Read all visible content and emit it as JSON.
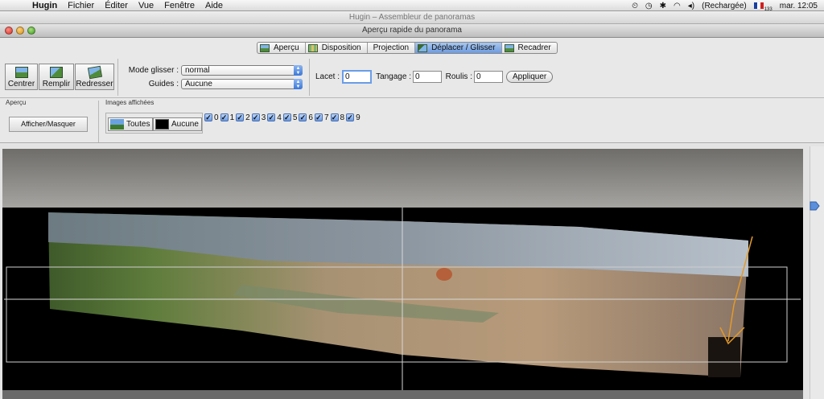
{
  "menubar": {
    "app": "Hugin",
    "items": [
      "Fichier",
      "Éditer",
      "Vue",
      "Fenêtre",
      "Aide"
    ],
    "battery": "(Rechargée)",
    "flag_number": "133",
    "clock": "mar. 12:05"
  },
  "windows": {
    "main_title": "Hugin – Assembleur de panoramas",
    "preview_title": "Aperçu rapide du panorama"
  },
  "tabs": [
    {
      "label": "Aperçu",
      "icon": "preview-icon"
    },
    {
      "label": "Disposition",
      "icon": "layout-icon"
    },
    {
      "label": "Projection",
      "icon": ""
    },
    {
      "label": "Déplacer / Glisser",
      "icon": "drag-icon",
      "active": true
    },
    {
      "label": "Recadrer",
      "icon": "crop-icon"
    }
  ],
  "toolbar": {
    "center": "Centrer",
    "fill": "Remplir",
    "straighten": "Redresser",
    "drag_mode_label": "Mode glisser :",
    "drag_mode_value": "normal",
    "guides_label": "Guides :",
    "guides_value": "Aucune",
    "yaw_label": "Lacet :",
    "yaw_value": "0",
    "pitch_label": "Tangage :",
    "pitch_value": "0",
    "roll_label": "Roulis :",
    "roll_value": "0",
    "apply": "Appliquer"
  },
  "row2": {
    "preview_section": "Aperçu",
    "images_section": "Images affichées",
    "show_hide": "Afficher/Masquer",
    "all": "Toutes",
    "none": "Aucune",
    "images": [
      "0",
      "1",
      "2",
      "3",
      "4",
      "5",
      "6",
      "7",
      "8",
      "9"
    ]
  },
  "colors": {
    "accent": "#5b8fdc",
    "canvas_bg": "#000000",
    "horizon_gray": "#8a8987",
    "guide_line": "#c8c8c8",
    "control_line": "#e39a2a"
  }
}
